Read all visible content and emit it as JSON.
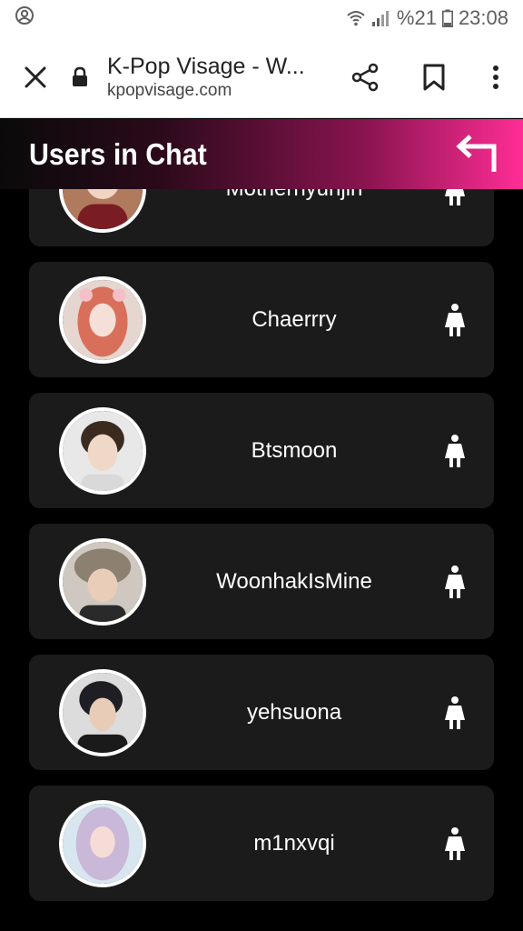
{
  "status_bar": {
    "battery_label": "%21",
    "time": "23:08",
    "icons": [
      "account-circle-icon",
      "wifi-icon",
      "signal-icon",
      "battery-icon"
    ]
  },
  "browser": {
    "page_title": "K-Pop Visage - W...",
    "domain": "kpopvisage.com",
    "icons": [
      "close-icon",
      "lock-icon",
      "share-icon",
      "bookmark-icon",
      "more-vert-icon"
    ]
  },
  "header": {
    "title": "Users in Chat",
    "back_icon": "return-arrow-icon"
  },
  "users": [
    {
      "name": "Motherhyunjin",
      "gender_icon": "female-icon",
      "avatar_color": "#b07a5e"
    },
    {
      "name": "Chaerrry",
      "gender_icon": "female-icon",
      "avatar_color": "#d86f5a"
    },
    {
      "name": "Btsmoon",
      "gender_icon": "female-icon",
      "avatar_color": "#3a2a20"
    },
    {
      "name": "WoonhakIsMine",
      "gender_icon": "female-icon",
      "avatar_color": "#8c8070"
    },
    {
      "name": "yehsuona",
      "gender_icon": "female-icon",
      "avatar_color": "#1e1e24"
    },
    {
      "name": "m1nxvqi",
      "gender_icon": "female-icon",
      "avatar_color": "#c9b8d8"
    }
  ],
  "colors": {
    "background": "#000000",
    "card": "#1b1b1b",
    "accent": "#ff2d95",
    "text": "#ffffff"
  }
}
